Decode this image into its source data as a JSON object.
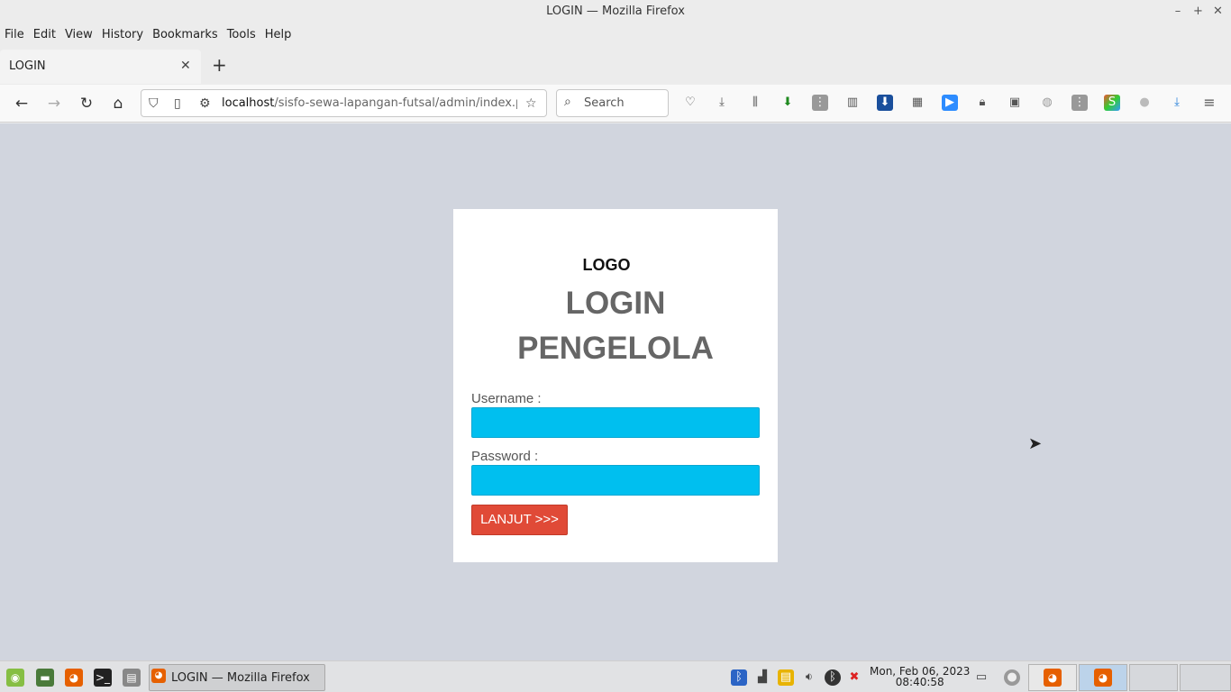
{
  "window": {
    "title": "LOGIN — Mozilla Firefox"
  },
  "menubar": {
    "items": [
      "File",
      "Edit",
      "View",
      "History",
      "Bookmarks",
      "Tools",
      "Help"
    ]
  },
  "tabs": {
    "active_title": "LOGIN"
  },
  "urlbar": {
    "host": "localhost",
    "path": "/sisfo-sewa-lapangan-futsal/admin/index.php"
  },
  "search": {
    "placeholder": "Search"
  },
  "page": {
    "logo": "LOGO",
    "title_line1": "LOGIN",
    "title_line2": "PENGELOLA",
    "username_label": "Username :",
    "password_label": "Password :",
    "submit_label": "LANJUT >>>"
  },
  "colors": {
    "page_bg": "#d1d5de",
    "input_bg": "#00bfef",
    "button_bg": "#e04a37"
  },
  "taskbar": {
    "task_label": "LOGIN — Mozilla Firefox",
    "date": "Mon, Feb 06, 2023",
    "time": "08:40:58"
  }
}
